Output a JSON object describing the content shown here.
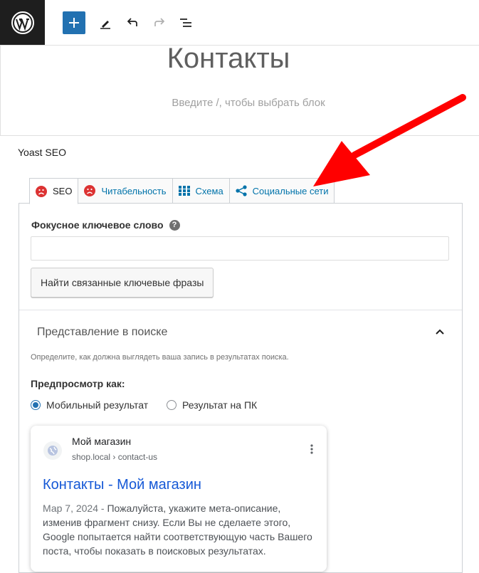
{
  "toolbar": {
    "logo_icon": "wordpress-logo",
    "add_icon": "plus-icon",
    "edit_icon": "pencil-icon",
    "undo_icon": "undo-icon",
    "redo_icon": "redo-icon",
    "outline_icon": "list-view-icon",
    "accent": "#2271b1"
  },
  "editor": {
    "title": "Контакты",
    "placeholder": "Введите /, чтобы выбрать блок"
  },
  "yoast": {
    "panel_title": "Yoast SEO",
    "tabs": [
      {
        "label": "SEO",
        "icon": "sad-face-icon",
        "active": true
      },
      {
        "label": "Читабельность",
        "icon": "sad-face-icon",
        "active": false
      },
      {
        "label": "Схема",
        "icon": "grid-icon",
        "active": false
      },
      {
        "label": "Социальные сети",
        "icon": "share-icon",
        "active": false
      }
    ],
    "focus_keyword_label": "Фокусное ключевое слово",
    "focus_keyword_value": "",
    "related_button": "Найти связанные ключевые фразы",
    "search_section_title": "Представление в поиске",
    "search_section_desc": "Определите, как должна выглядеть ваша запись в результатах поиска.",
    "preview_label": "Предпросмотр как:",
    "radio_options": [
      {
        "label": "Мобильный результат",
        "checked": true
      },
      {
        "label": "Результат на ПК",
        "checked": false
      }
    ]
  },
  "google_preview": {
    "site_name": "Мой магазин",
    "url": "shop.local › contact-us",
    "title": "Контакты - Мой магазин",
    "date": "Мар 7, 2024",
    "separator": " - ",
    "description": "Пожалуйста, укажите мета-описание, изменив фрагмент снизу. Если Вы не сделаете этого, Google попытается найти соответствующую часть Вашего поста, чтобы показать в поисковых результатах."
  },
  "colors": {
    "sad_face": "#dc3232",
    "link_blue": "#0073aa",
    "annotation_arrow": "#ff0000"
  }
}
